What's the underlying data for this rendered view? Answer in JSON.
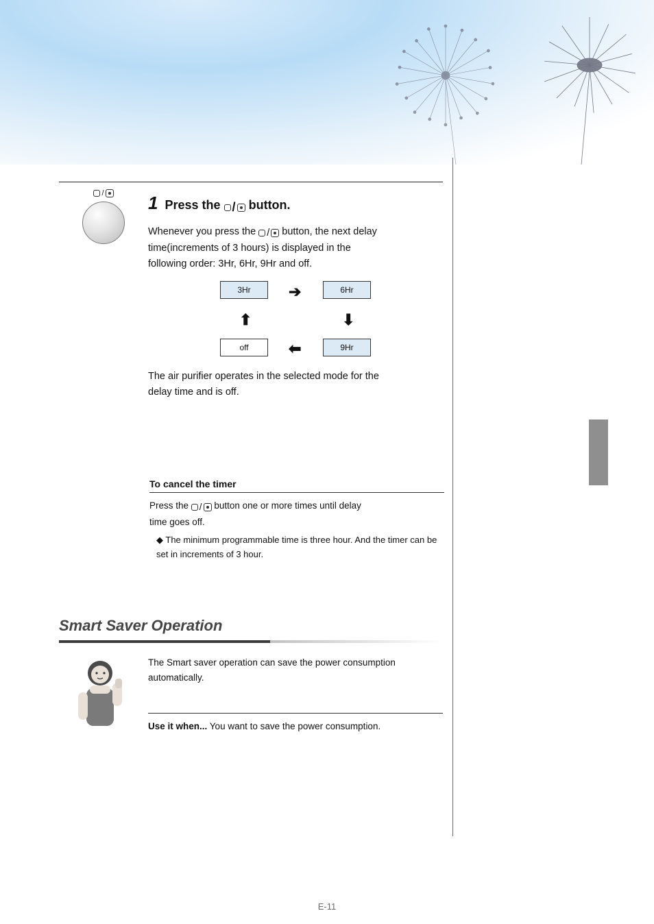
{
  "icons": {
    "timer_glyph": "timer-icon"
  },
  "step1": {
    "num": "1",
    "title_before_icon": "Press the ",
    "title_after_icon": " button.",
    "line_after_title": "Whenever you press the ",
    "line_after_title_2": " button, the next delay",
    "line_after_title_3": "time(increments of 3 hours) is displayed in the",
    "line_after_title_4": "following order: 3Hr, 6Hr, 9Hr and off.",
    "line2": "The air purifier operates in the selected mode for the",
    "line3": "delay time and is off."
  },
  "cycle": {
    "items": [
      "3Hr",
      "6Hr",
      "9Hr",
      "off"
    ]
  },
  "cancel": {
    "heading": "To cancel the timer",
    "body_1": "Press the ",
    "body_2": " button one or more times until delay",
    "body_3": "time goes off.",
    "bullet": "The minimum programmable time is three hour. And the timer can be set in increments of 3 hour."
  },
  "smart": {
    "section_title": "Smart Saver Operation",
    "intro": "The Smart saver operation can save the power consumption automatically.",
    "use_label": "Use it when...",
    "use_text": "You want to save the power consumption."
  },
  "page_number": "E-11"
}
